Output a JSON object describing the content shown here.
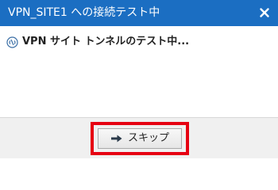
{
  "window": {
    "title": "VPN_SITE1 への接続テスト中"
  },
  "status": {
    "icon": "vpn-tunnel-icon",
    "text": "VPN サイト トンネルのテスト中..."
  },
  "footer": {
    "skip_label": "スキップ",
    "skip_icon": "arrow-right-icon",
    "highlight_color": "#e60012"
  },
  "colors": {
    "titlebar": "#1b6ec2",
    "footer_bg": "#f0f0f0"
  }
}
